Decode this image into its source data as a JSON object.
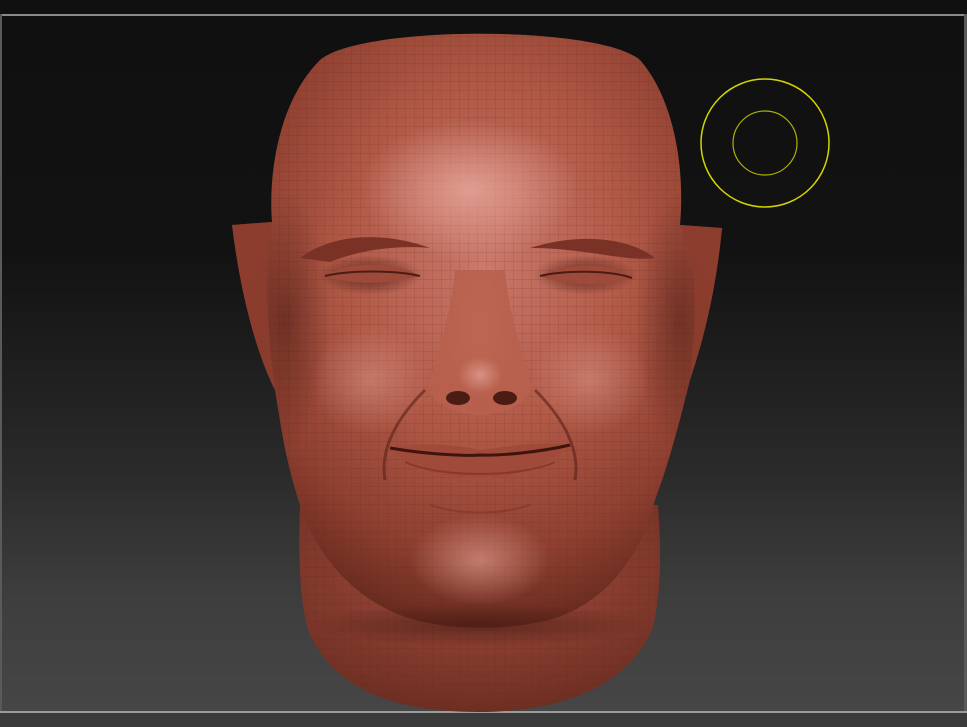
{
  "viewport": {
    "name": "3d-sculpt-viewport",
    "model": "sculpted-head-mesh",
    "material_color": "#b25a48",
    "background_top": "#101010",
    "background_bottom": "#474747",
    "brush_cursor_color": "#d4d400"
  }
}
